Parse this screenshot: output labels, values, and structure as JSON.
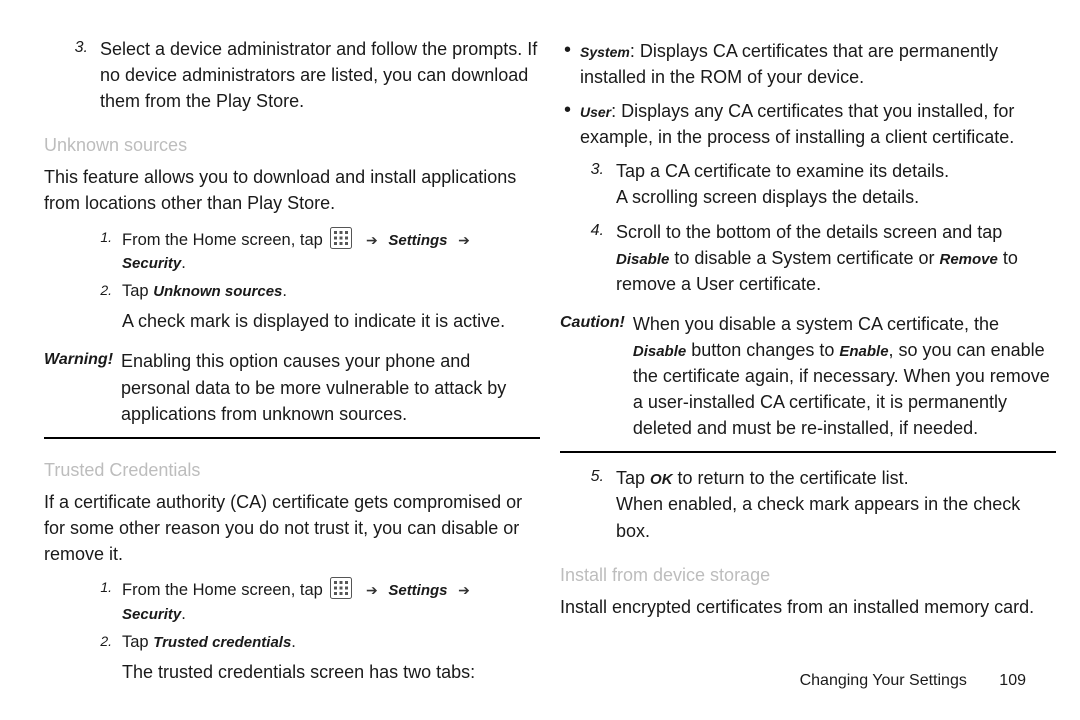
{
  "left": {
    "item3_num": "3.",
    "item3_text": "Select a device administrator and follow the prompts. If no device administrators are listed, you can download them from the Play Store.",
    "unknown_title": "Unknown sources",
    "unknown_para": "This feature allows you to download and install applications from locations other than Play Store.",
    "step1_num": "1.",
    "step1_prefix": "From the Home screen, tap ",
    "step1_settings": "Settings",
    "step1_security": "Security",
    "step1_period": ".",
    "step2_num": "2.",
    "step2_prefix": "Tap ",
    "step2_label": "Unknown sources",
    "step2_period": ".",
    "step2_result": "A check mark is displayed to indicate it is active.",
    "warning_label": "Warning!",
    "warning_text": "Enabling this option causes your phone and personal data to be more vulnerable to attack by applications from unknown sources.",
    "trusted_title": "Trusted Credentials",
    "trusted_para": "If a certificate authority (CA) certificate gets compromised or for some other reason you do not trust it, you can disable or remove it.",
    "tc_step1_num": "1.",
    "tc_step1_prefix": "From the Home screen, tap ",
    "tc_step1_settings": "Settings",
    "tc_step1_security": "Security",
    "tc_step1_period": ".",
    "tc_step2_num": "2.",
    "tc_step2_prefix": "Tap ",
    "tc_step2_label": "Trusted credentials",
    "tc_step2_period": ".",
    "tc_step2_result": "The trusted credentials screen has two tabs:"
  },
  "right": {
    "sys_label": "System",
    "sys_text": ": Displays CA certificates that are permanently installed in the ROM of your device.",
    "user_label": "User",
    "user_text": ": Displays any CA certificates that you installed, for example, in the process of installing a client certificate.",
    "step3_num": "3.",
    "step3_line1": "Tap a CA certificate to examine its details.",
    "step3_line2": "A scrolling screen displays the details.",
    "step4_num": "4.",
    "step4_prefix": "Scroll to the bottom of the details screen and tap ",
    "step4_disable": "Disable",
    "step4_mid1": " to disable a System certificate or ",
    "step4_remove": "Remove",
    "step4_mid2": " to remove a User certificate.",
    "caution_label": "Caution!",
    "caution_prefix": "When you disable a system CA certificate, the ",
    "caution_disable": "Disable",
    "caution_mid1": " button changes to ",
    "caution_enable": "Enable",
    "caution_tail": ", so you can enable the certificate again, if necessary. When you remove a user-installed CA certificate, it is permanently deleted and must be re-installed, if needed.",
    "step5_num": "5.",
    "step5_prefix": "Tap ",
    "step5_ok": "OK",
    "step5_suffix": " to return to the certificate list.",
    "step5_line2": "When enabled, a check mark appears in the check box.",
    "install_title": "Install from device storage",
    "install_para": "Install encrypted certificates from an installed memory card."
  },
  "footer": {
    "section": "Changing Your Settings",
    "page": "109"
  },
  "icons": {
    "grid": "apps-grid-icon"
  }
}
